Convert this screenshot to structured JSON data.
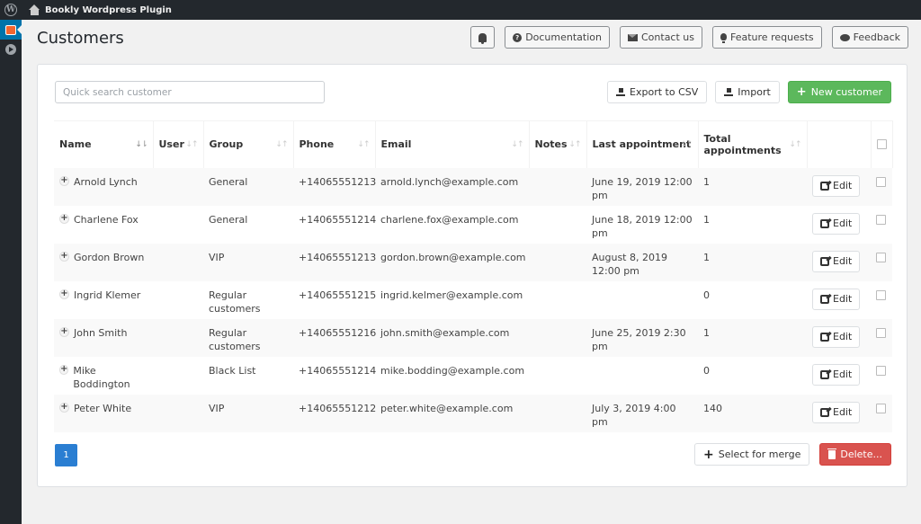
{
  "adminbar": {
    "site_name": "Bookly Wordpress Plugin",
    "wp_logo": "W"
  },
  "page": {
    "title": "Customers"
  },
  "top_actions": {
    "documentation": "Documentation",
    "contact_us": "Contact us",
    "feature_requests": "Feature requests",
    "feedback": "Feedback"
  },
  "search": {
    "placeholder": "Quick search customer",
    "value": ""
  },
  "panel_actions": {
    "export": "Export to CSV",
    "import": "Import",
    "new_customer": "New customer"
  },
  "table": {
    "columns": {
      "name": "Name",
      "user": "User",
      "group": "Group",
      "phone": "Phone",
      "email": "Email",
      "notes": "Notes",
      "last_appointment": "Last appointment",
      "total_appointments": "Total appointments"
    },
    "sort_active": "↓⇡",
    "sort_idle": "↓↑",
    "edit_label": "Edit",
    "rows": [
      {
        "name": "Arnold Lynch",
        "user": "",
        "group": "General",
        "phone": "+14065551213",
        "email": "arnold.lynch@example.com",
        "notes": "",
        "last_appointment": "June 19, 2019 12:00 pm",
        "total": "1"
      },
      {
        "name": "Charlene Fox",
        "user": "",
        "group": "General",
        "phone": "+14065551214",
        "email": "charlene.fox@example.com",
        "notes": "",
        "last_appointment": "June 18, 2019 12:00 pm",
        "total": "1"
      },
      {
        "name": "Gordon Brown",
        "user": "",
        "group": "VIP",
        "phone": "+14065551213",
        "email": "gordon.brown@example.com",
        "notes": "",
        "last_appointment": "August 8, 2019 12:00 pm",
        "total": "1"
      },
      {
        "name": "Ingrid Klemer",
        "user": "",
        "group": "Regular customers",
        "phone": "+14065551215",
        "email": "ingrid.kelmer@example.com",
        "notes": "",
        "last_appointment": "",
        "total": "0"
      },
      {
        "name": "John Smith",
        "user": "",
        "group": "Regular customers",
        "phone": "+14065551216",
        "email": "john.smith@example.com",
        "notes": "",
        "last_appointment": "June 25, 2019 2:30 pm",
        "total": "1"
      },
      {
        "name": "Mike Boddington",
        "user": "",
        "group": "Black List",
        "phone": "+14065551214",
        "email": "mike.bodding@example.com",
        "notes": "",
        "last_appointment": "",
        "total": "0"
      },
      {
        "name": "Peter White",
        "user": "",
        "group": "VIP",
        "phone": "+14065551212",
        "email": "peter.white@example.com",
        "notes": "",
        "last_appointment": "July 3, 2019 4:00 pm",
        "total": "140"
      }
    ]
  },
  "pagination": {
    "current": "1"
  },
  "bottom_actions": {
    "merge": "Select for merge",
    "delete": "Delete..."
  }
}
